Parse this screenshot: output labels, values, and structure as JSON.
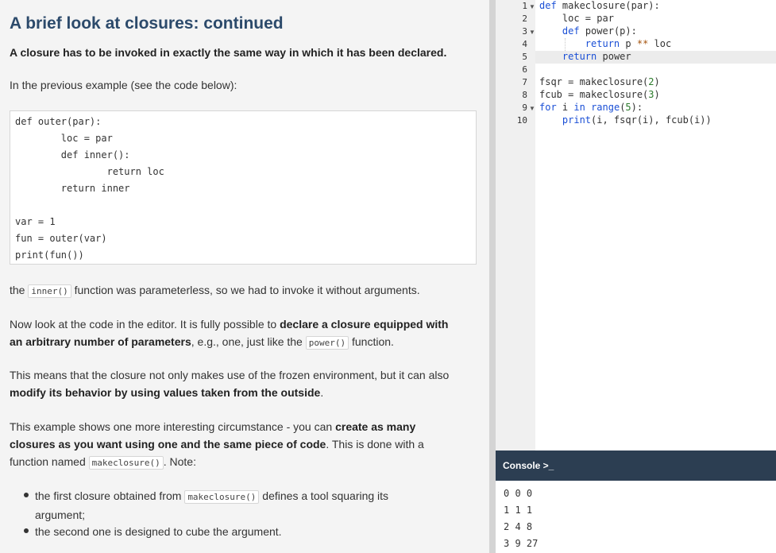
{
  "lesson": {
    "title": "A brief look at closures: continued",
    "lead": "A closure has to be invoked in exactly the same way in which it has been declared.",
    "intro": "In the previous example (see the code below):",
    "example_code": [
      "def outer(par):",
      "        loc = par",
      "        def inner():",
      "                return loc",
      "        return inner",
      "",
      "var = 1",
      "fun = outer(var)",
      "print(fun())"
    ],
    "p1": {
      "before": "the ",
      "code": "inner()",
      "after": " function was parameterless, so we had to invoke it without arguments."
    },
    "p2": {
      "t1": "Now look at the code in the editor. It is fully possible to ",
      "b1": "declare a closure equipped with",
      "b2": "an arbitrary number of parameters",
      "t2": ", e.g., one, just like the ",
      "code": "power()",
      "t3": " function."
    },
    "p3": {
      "t1": "This means that the closure not only makes use of the frozen environment, but it can also",
      "b1": "modify its behavior by using values taken from the outside",
      "t2": "."
    },
    "p4": {
      "t1": "This example shows one more interesting circumstance - you can ",
      "b1": "create as many",
      "b2": "closures as you want using one and the same piece of code",
      "t2": ". This is done with a",
      "t3": "function named ",
      "code": "makeclosure()",
      "t4": ". Note:"
    },
    "bullets": [
      {
        "t1": "the first closure obtained from ",
        "code": "makeclosure()",
        "t2": " defines a tool squaring its",
        "t3": "argument;"
      },
      {
        "t1": "the second one is designed to cube the argument."
      }
    ]
  },
  "editor": {
    "line_numbers": [
      "1",
      "2",
      "3",
      "4",
      "5",
      "6",
      "7",
      "8",
      "9",
      "10"
    ]
  },
  "console": {
    "title": "Console >_",
    "output": [
      "0 0 0",
      "1 1 1",
      "2 4 8",
      "3 9 27"
    ]
  },
  "colors": {
    "heading": "#2c4a6b",
    "keyword": "#1a4fd6",
    "number": "#2a7a2a",
    "console_bar": "#2c3e52"
  }
}
